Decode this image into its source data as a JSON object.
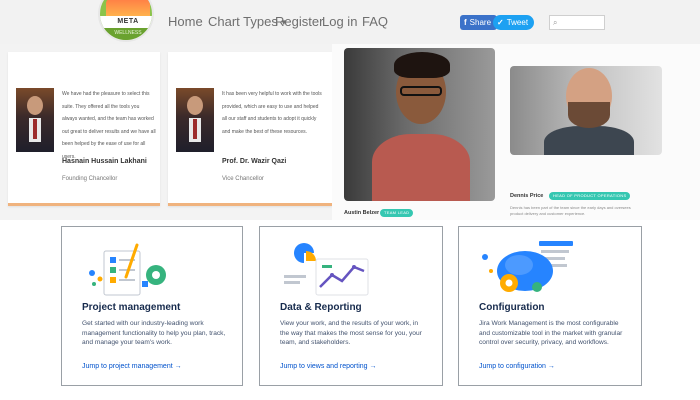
{
  "nav": {
    "logo_text": "META",
    "logo_subtext": "WELLNESS",
    "links": [
      {
        "label": "Home"
      },
      {
        "label": "Chart Types"
      },
      {
        "label": "Register"
      },
      {
        "label": "Log in"
      },
      {
        "label": "FAQ"
      }
    ],
    "share_label": "Share",
    "tweet_label": "Tweet",
    "search_placeholder": ""
  },
  "testimonials": [
    {
      "quote": "We have had the pleasure to select this suite. They offered all the tools you always wanted, and the team has worked out great to deliver results and we have all been helped by the ease of use for all users.",
      "name": "Hasnain Hussain Lakhani",
      "role": "Founding Chancellor"
    },
    {
      "quote": "It has been very helpful to work with the tools provided, which are easy to use and helped all our staff and students to adopt it quickly and make the best of these resources.",
      "name": "Prof. Dr. Wazir Qazi",
      "role": "Vice Chancellor"
    }
  ],
  "team": [
    {
      "name": "Austin Belzer",
      "badge": "TEAM LEAD"
    },
    {
      "name": "Dennis Price",
      "badge": "HEAD OF PRODUCT OPERATIONS",
      "desc": "Dennis has been part of the team since the early days and oversees product delivery and customer experience."
    }
  ],
  "features": [
    {
      "icon": "checklist-gear-icon",
      "title": "Project management",
      "desc": "Get started with our industry-leading work management functionality to help you plan, track, and manage your team's work.",
      "link": "Jump to project management →"
    },
    {
      "icon": "chart-report-icon",
      "title": "Data & Reporting",
      "desc": "View your work, and the results of your work, in the way that makes the most sense for you, your team, and stakeholders.",
      "link": "Jump to views and reporting →"
    },
    {
      "icon": "settings-cloud-icon",
      "title": "Configuration",
      "desc": "Jira Work Management is the most configurable and customizable tool in the market with granular control over security, privacy, and workflows.",
      "link": "Jump to configuration →"
    }
  ],
  "colors": {
    "nav_bg": "#f2f2f2",
    "accent_teal": "#35c7b1",
    "link_blue": "#0052cc",
    "title_navy": "#172b4d",
    "card_border_orange": "#f0b37e"
  }
}
